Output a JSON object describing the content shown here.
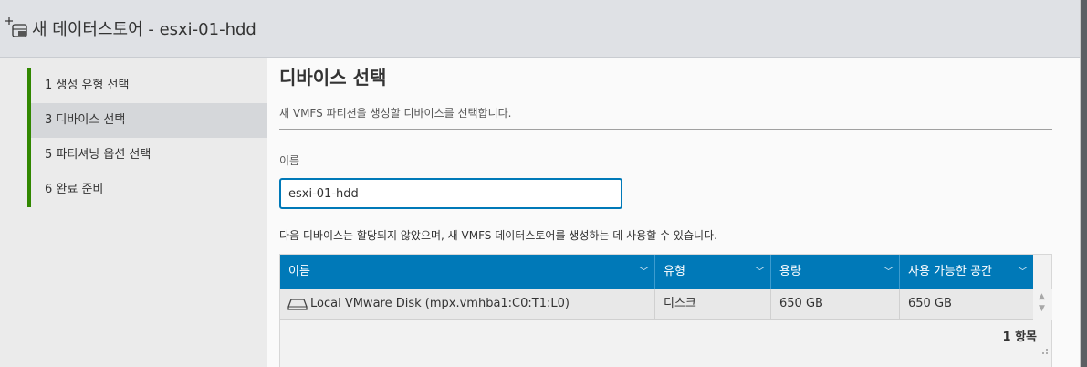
{
  "window": {
    "title": "새 데이터스토어 - esxi-01-hdd"
  },
  "wizard": {
    "steps": [
      {
        "label": "1  생성 유형 선택",
        "active": false
      },
      {
        "label": "3  디바이스 선택",
        "active": true
      },
      {
        "label": "5  파티셔닝 옵션 선택",
        "active": false
      },
      {
        "label": "6  완료 준비",
        "active": false
      }
    ],
    "accent_color": "#318700"
  },
  "page": {
    "title": "디바이스 선택",
    "description": "새 VMFS 파티션을 생성할 디바이스를 선택합니다.",
    "name_label": "이름",
    "name_value": "esxi-01-hdd",
    "info_text": "다음 디바이스는 할당되지 않았으며, 새 VMFS 데이터스토어를 생성하는 데 사용할 수 있습니다."
  },
  "table": {
    "header_color": "#0079b8",
    "columns": [
      "이름",
      "유형",
      "용량",
      "사용 가능한 공간"
    ],
    "rows": [
      {
        "icon": "disk-icon",
        "name": "Local VMware Disk (mpx.vmhba1:C0:T1:L0)",
        "type": "디스크",
        "capacity": "650 GB",
        "free": "650 GB"
      }
    ],
    "count_label": "1 항목"
  }
}
